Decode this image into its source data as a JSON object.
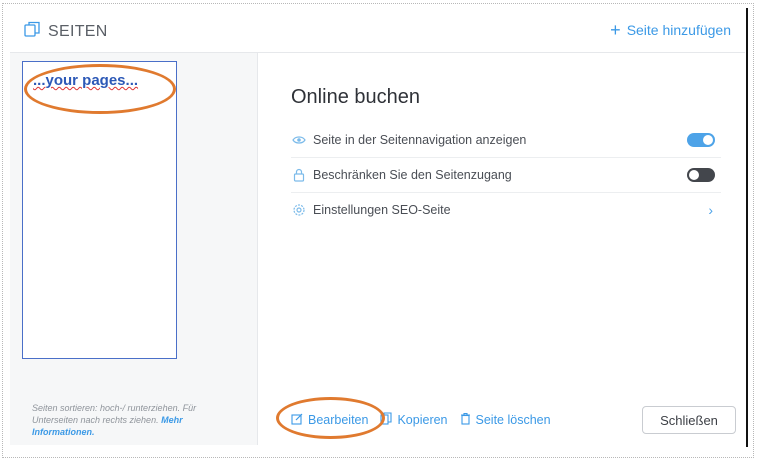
{
  "header": {
    "title": "SEITEN",
    "add_label": "Seite hinzufügen"
  },
  "sidebar": {
    "page_placeholder": "...your pages...",
    "hint_text": "Seiten sortieren: hoch-/ runterziehen. Für Unterseiten nach rechts ziehen.",
    "hint_link": "Mehr Informationen."
  },
  "main": {
    "page_title": "Online buchen",
    "settings": [
      {
        "label": "Seite in der Seitennavigation anzeigen",
        "icon": "eye-icon",
        "toggle": true
      },
      {
        "label": "Beschränken Sie den Seitenzugang",
        "icon": "lock-icon",
        "toggle": false
      },
      {
        "label": "Einstellungen SEO-Seite",
        "icon": "gear-icon"
      }
    ]
  },
  "footer": {
    "edit_label": "Bearbeiten",
    "copy_label": "Kopieren",
    "delete_label": "Seite löschen",
    "close_label": "Schließen"
  },
  "colors": {
    "accent": "#3b99e6",
    "highlight_oval": "#e07a2f",
    "toggle_on": "#4da3e8",
    "toggle_off": "#43464c"
  }
}
